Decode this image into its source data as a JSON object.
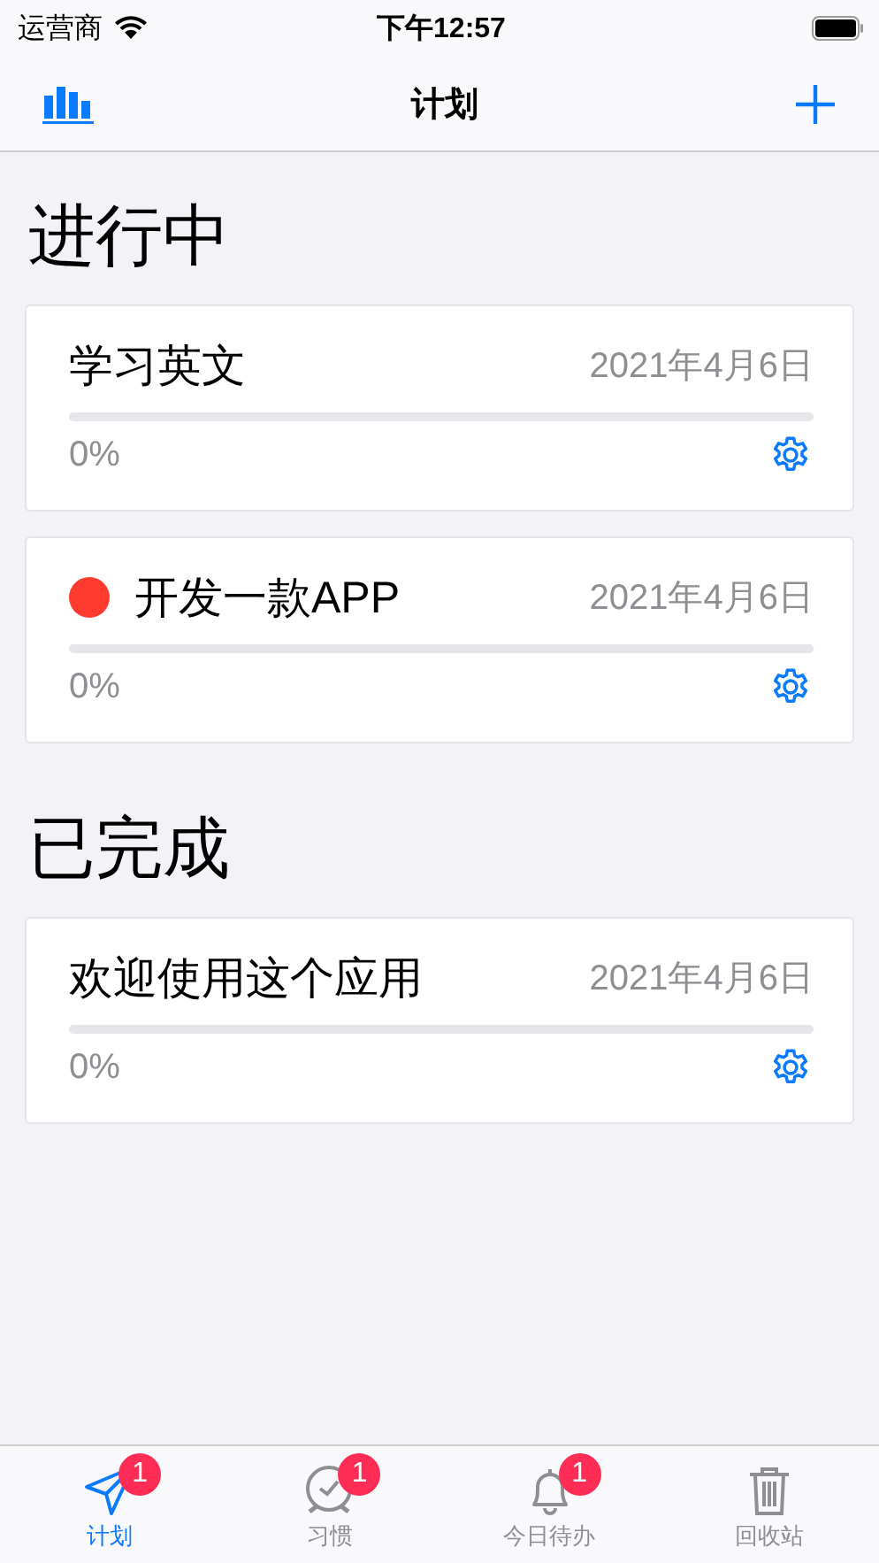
{
  "status_bar": {
    "carrier": "运营商",
    "time": "下午12:57"
  },
  "nav": {
    "title": "计划"
  },
  "sections": [
    {
      "title": "进行中",
      "plans": [
        {
          "name": "学习英文",
          "date": "2021年4月6日",
          "level": 0,
          "percent": "0%"
        },
        {
          "name": "开发一款APP",
          "date": "2021年4月6日",
          "level": 0,
          "percent": "0%",
          "color": "#ff3b30"
        }
      ]
    },
    {
      "title": "已完成",
      "plans": [
        {
          "name": "欢迎使用这个应用",
          "date": "2021年4月6日",
          "level": 0,
          "percent": "0%"
        }
      ]
    }
  ],
  "tabs": [
    {
      "kind": "plane",
      "label": "计划",
      "selected": true,
      "badge": "1"
    },
    {
      "kind": "clock",
      "label": "习惯",
      "selected": false,
      "badge": "1"
    },
    {
      "kind": "bell",
      "label": "今日待办",
      "selected": false,
      "badge": "1"
    },
    {
      "kind": "trash",
      "label": "回收站",
      "selected": false
    }
  ]
}
